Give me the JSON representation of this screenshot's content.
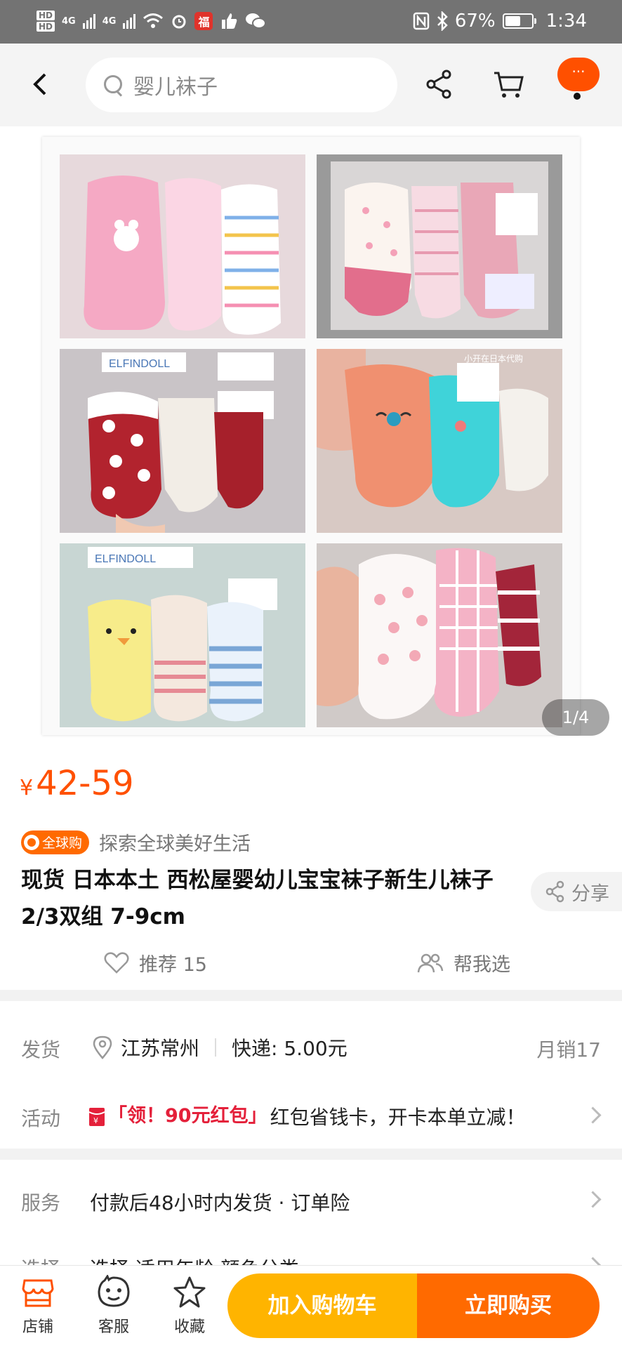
{
  "status_bar": {
    "hd1": "HD",
    "hd2": "HD",
    "net1": "4G",
    "net2": "4G",
    "battery_percent": "67%",
    "time": "1:34",
    "battery_level": 0.67
  },
  "nav": {
    "search_placeholder": "婴儿袜子",
    "menu_label": "···"
  },
  "gallery": {
    "counter": "1/4",
    "watermark": "小开在日本代购",
    "brand_label": "ELFINDOLL"
  },
  "product": {
    "currency": "¥",
    "price": "42-59",
    "global_badge": "全球购",
    "tagline": "探索全球美好生活",
    "title": "现货 日本本土 西松屋婴幼儿宝宝袜子新生儿袜子 2/3双组 7-9cm",
    "share_label": "分享",
    "recommend_label": "推荐 15",
    "help_choose_label": "帮我选"
  },
  "shipping": {
    "label": "发货",
    "location": "江苏常州",
    "express": "快递: 5.00元",
    "monthly_sales": "月销17"
  },
  "activity": {
    "label": "活动",
    "coupon": "「领！90元红包」",
    "text": "红包省钱卡，开卡本单立减！"
  },
  "service": {
    "label": "服务",
    "text": "付款后48小时内发货 · 订单险"
  },
  "select": {
    "label": "选择",
    "text": "选择 适用年龄 颜色分类"
  },
  "bottom": {
    "shop": "店铺",
    "service": "客服",
    "favorite": "收藏",
    "add_to_cart": "加入购物车",
    "buy_now": "立即购买"
  },
  "colors": {
    "accent": "#ff5000",
    "cart_button": "#ffb400",
    "buy_button": "#ff6a00",
    "coupon_red": "#e4203a"
  }
}
